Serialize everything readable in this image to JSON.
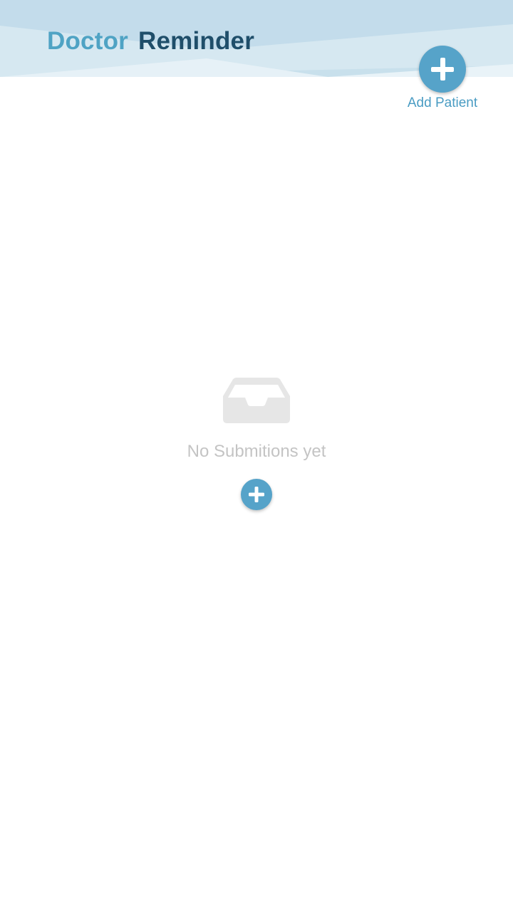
{
  "header": {
    "title_part1": "Doctor",
    "title_part2": "Reminder"
  },
  "add_patient": {
    "label": "Add Patient",
    "icon": "plus-icon"
  },
  "empty_state": {
    "icon": "inbox-icon",
    "message": "No Submitions yet",
    "add_icon": "plus-icon"
  },
  "colors": {
    "header_background": "#c8e0ec",
    "title_primary": "#4fa3c4",
    "title_secondary": "#1f4e6a",
    "accent": "#56a3c9",
    "empty_text": "#c4c4c4",
    "empty_icon": "#e6e6e6"
  }
}
